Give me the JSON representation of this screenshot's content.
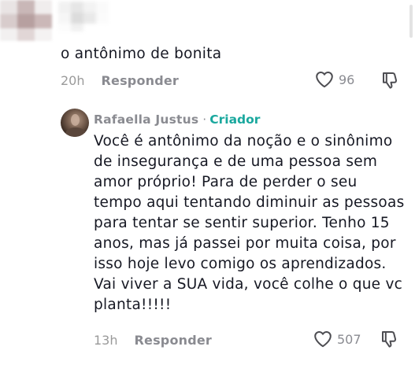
{
  "top_comment": {
    "text": "o antônimo de bonita",
    "time": "20h",
    "reply_label": "Responder",
    "likes": "96"
  },
  "reply_comment": {
    "username": "Rafaella Justus",
    "separator": "·",
    "badge": "Criador",
    "lines": [
      "Você é antônimo da noção e o sinônimo",
      "de insegurança e de uma pessoa sem",
      "amor próprio! Para de perder o seu",
      "tempo aqui tentando diminuir as pessoas",
      "para tentar se sentir superior. Tenho 15",
      "anos, mas já passei por muita coisa, por",
      "isso hoje levo comigo os aprendizados.",
      "Vai viver a SUA vida, você colhe o que vc",
      "planta!!!!!"
    ],
    "time": "13h",
    "reply_label": "Responder",
    "likes": "507"
  },
  "icons": {
    "like": "heart-outline-icon",
    "dislike": "thumbs-down-icon"
  },
  "colors": {
    "text": "#161823",
    "muted": "#8a8b91",
    "creator_badge": "#1aa89e",
    "background": "#ffffff"
  }
}
